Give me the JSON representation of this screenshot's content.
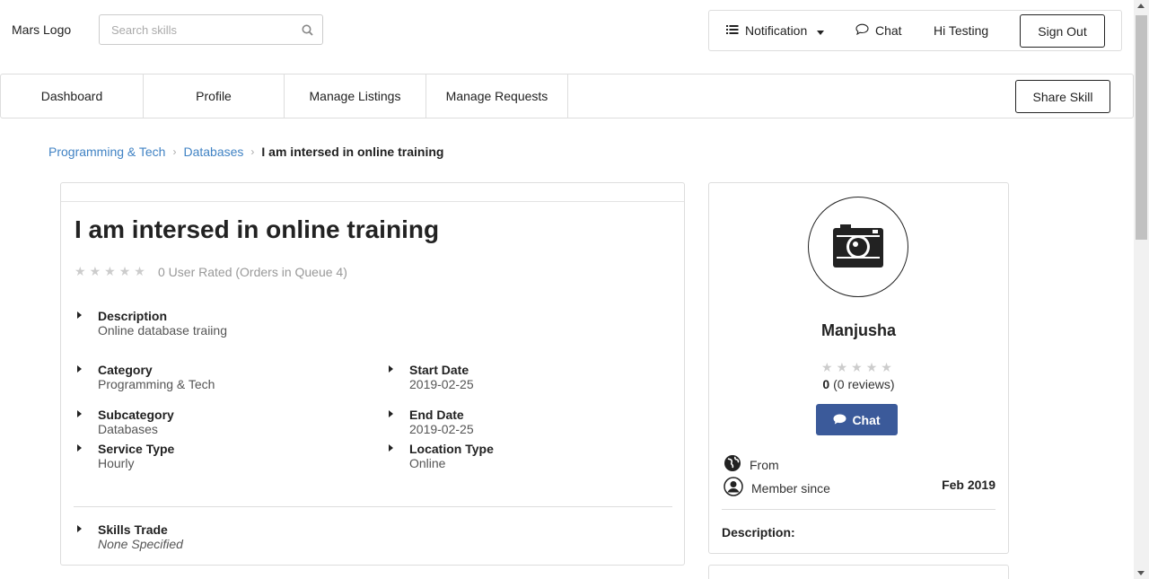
{
  "header": {
    "logo": "Mars Logo",
    "search_placeholder": "Search skills",
    "notification_label": "Notification",
    "chat_label": "Chat",
    "greeting": "Hi Testing",
    "signout_label": "Sign Out"
  },
  "nav": {
    "tabs": [
      {
        "label": "Dashboard"
      },
      {
        "label": "Profile"
      },
      {
        "label": "Manage Listings"
      },
      {
        "label": "Manage Requests"
      }
    ],
    "share_label": "Share Skill"
  },
  "breadcrumb": {
    "items": [
      "Programming & Tech",
      "Databases"
    ],
    "current": "I am intersed in online training"
  },
  "skill": {
    "title": "I am intersed in online training",
    "rating_text": "0 User Rated (Orders in Queue 4)",
    "rating_stars": 0,
    "description_label": "Description",
    "description": "Online database traiing",
    "category_label": "Category",
    "category": "Programming & Tech",
    "start_date_label": "Start Date",
    "start_date": "2019-02-25",
    "subcategory_label": "Subcategory",
    "subcategory": "Databases",
    "end_date_label": "End Date",
    "end_date": "2019-02-25",
    "service_type_label": "Service Type",
    "service_type": "Hourly",
    "location_type_label": "Location Type",
    "location_type": "Online",
    "skills_trade_label": "Skills Trade",
    "skills_trade": "None Specified"
  },
  "profile": {
    "name": "Manjusha",
    "rating_stars": 0,
    "rating_value": "0",
    "reviews": "(0 reviews)",
    "chat_label": "Chat",
    "from_label": "From",
    "member_since_label": "Member since",
    "member_since": "Feb 2019",
    "description_label": "Description:"
  },
  "colors": {
    "link": "#4183c4",
    "chat_button": "#3b5a9a"
  }
}
